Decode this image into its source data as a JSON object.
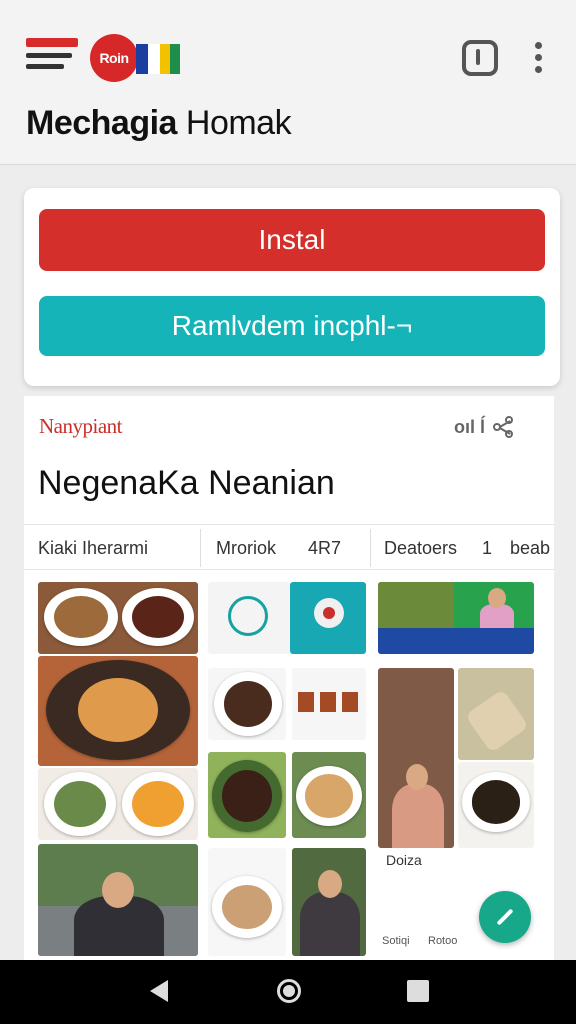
{
  "header": {
    "logo_text": "Roin",
    "title_bold": "Mechagia",
    "title_rest": " Homak"
  },
  "actions": {
    "install_label": "Instal",
    "second_label": "Ramlvdem incphl-¬"
  },
  "card": {
    "brand": "Nanypiant",
    "tools_text": "oıl ĺ",
    "section_title": "NegenaKa Neanian",
    "tabs": [
      {
        "label": "Kiaki Iherarmi"
      },
      {
        "label": "Mroriok"
      },
      {
        "label": "4R7"
      },
      {
        "label": "Deatoers"
      },
      {
        "label": "1"
      },
      {
        "label": "beab"
      }
    ]
  },
  "grid": {
    "col3_label": "Doiza"
  },
  "mini_nav": {
    "item1": "Sotiqi",
    "item2": "Rotoo"
  },
  "colors": {
    "install": "#d42f2a",
    "secondary": "#15b4b8",
    "fab": "#17a789",
    "brand": "#c9302c"
  },
  "icons": {
    "menu": "menu-icon",
    "shield": "shield-icon",
    "more": "more-vert-icon",
    "share": "share-icon",
    "fab": "edit-icon",
    "back": "back-icon",
    "home": "home-icon",
    "recent": "recent-apps-icon"
  }
}
